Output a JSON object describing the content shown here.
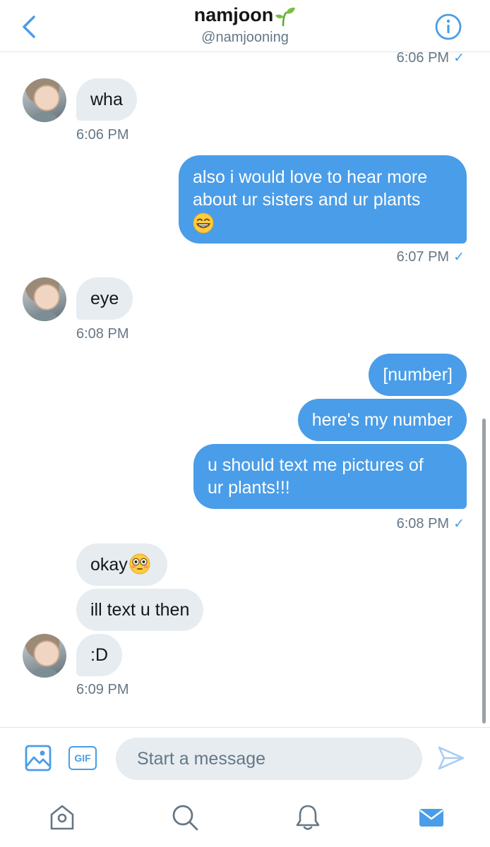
{
  "header": {
    "title": "namjoon",
    "title_emoji": "seedling",
    "handle": "@namjooning"
  },
  "messages": {
    "ts_out_1": "6:06 PM",
    "in_1_text": "wha",
    "ts_in_1": "6:06 PM",
    "out_2_line1": "also i would love to hear more",
    "out_2_line2": "about ur sisters and ur plants",
    "out_2_emoji": "grinning-face",
    "ts_out_2": "6:07 PM",
    "in_2_text": "eye",
    "ts_in_2": "6:08 PM",
    "out_3a_text": "[number]",
    "out_3b_text": "here's my number",
    "out_3c_line1": "u should text me pictures of",
    "out_3c_line2": "ur plants!!!",
    "ts_out_3": "6:08 PM",
    "in_3a_text": "okay",
    "in_3a_emoji": "flushed-face",
    "in_3b_text": "ill text u then",
    "in_3c_text": ":D",
    "ts_in_3": "6:09 PM",
    "read_check": "✓"
  },
  "composer": {
    "placeholder": "Start a message",
    "gif_label": "GIF"
  },
  "tabs": [
    "home",
    "search",
    "notifications",
    "messages"
  ],
  "active_tab": "messages",
  "colors": {
    "accent": "#4a9de8",
    "incoming_bubble": "#e6ecf0",
    "muted_text": "#657786"
  },
  "icons": [
    "back-chevron-icon",
    "info-icon",
    "image-icon",
    "gif-icon",
    "send-icon",
    "home-icon",
    "search-icon",
    "bell-icon",
    "mail-icon"
  ]
}
